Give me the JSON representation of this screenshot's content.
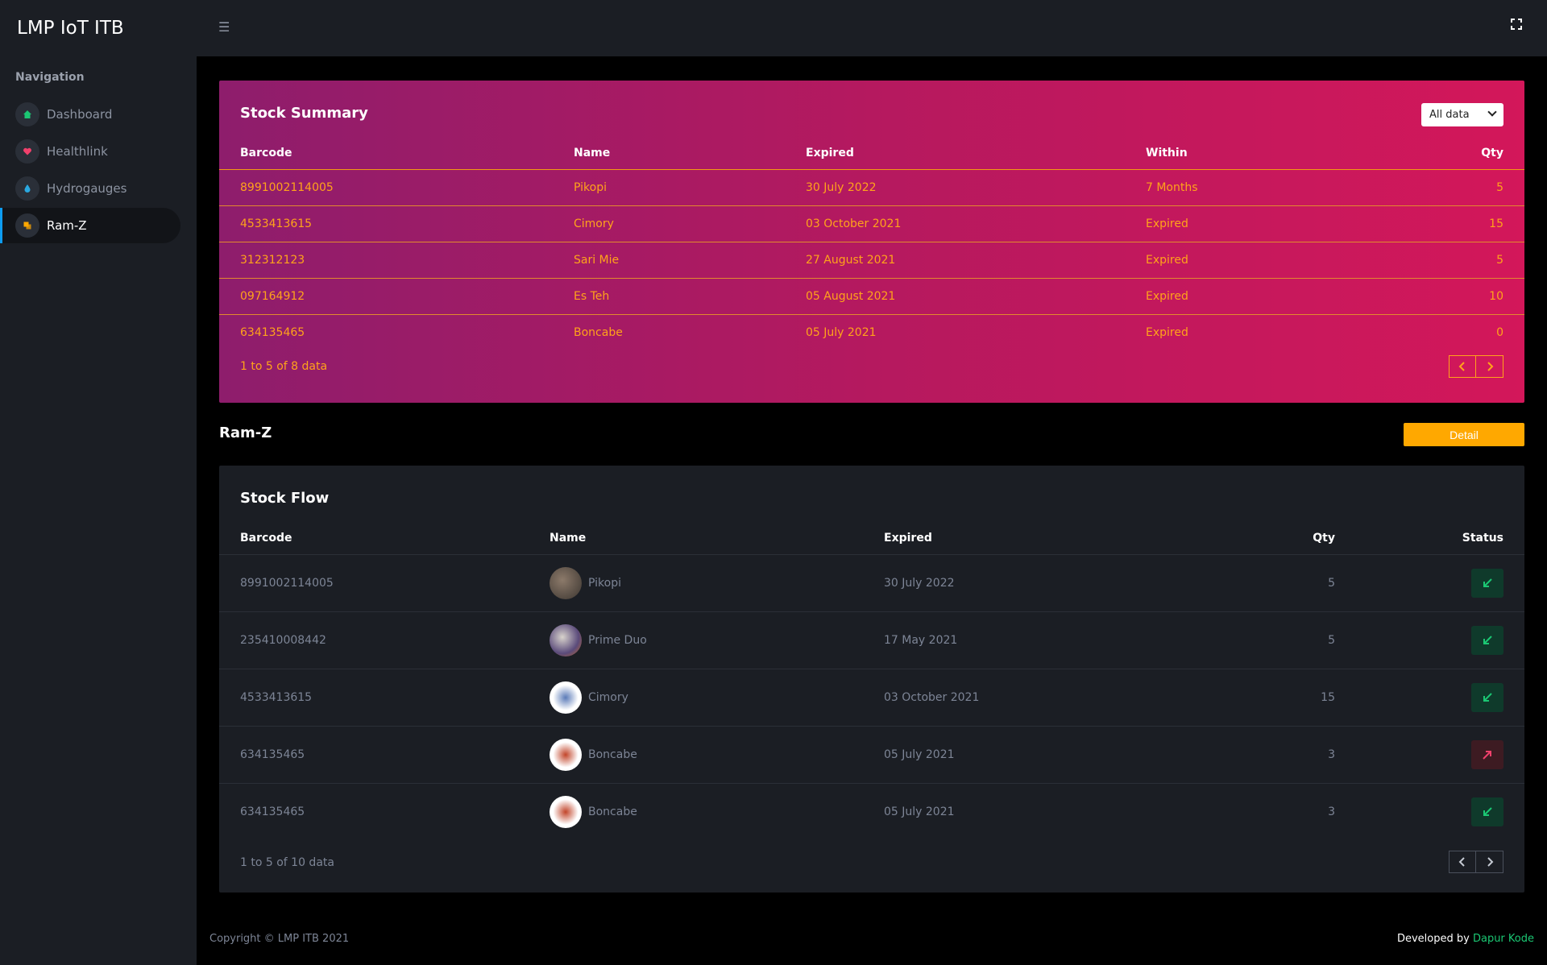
{
  "brand": "LMP IoT ITB",
  "navigation": {
    "heading": "Navigation",
    "items": [
      {
        "label": "Dashboard"
      },
      {
        "label": "Healthlink"
      },
      {
        "label": "Hydrogauges"
      },
      {
        "label": "Ram-Z"
      }
    ]
  },
  "topbar": {
    "menu_icon": "☰"
  },
  "stock_summary": {
    "title": "Stock Summary",
    "filter_value": "All data",
    "columns": [
      "Barcode",
      "Name",
      "Expired",
      "Within",
      "Qty"
    ],
    "rows": [
      [
        "8991002114005",
        "Pikopi",
        "30 July 2022",
        "7 Months",
        "5"
      ],
      [
        "4533413615",
        "Cimory",
        "03 October 2021",
        "Expired",
        "15"
      ],
      [
        "312312123",
        "Sari Mie",
        "27 August 2021",
        "Expired",
        "5"
      ],
      [
        "097164912",
        "Es Teh",
        "05 August 2021",
        "Expired",
        "10"
      ],
      [
        "634135465",
        "Boncabe",
        "05 July 2021",
        "Expired",
        "0"
      ]
    ],
    "pagination": "1 to 5 of 8 data"
  },
  "section": {
    "title": "Ram-Z",
    "detail_label": "Detail"
  },
  "stock_flow": {
    "title": "Stock Flow",
    "columns": [
      "Barcode",
      "Name",
      "Expired",
      "Qty",
      "Status"
    ],
    "rows": [
      {
        "barcode": "8991002114005",
        "name": "Pikopi",
        "expired": "30 July 2022",
        "qty": "5",
        "status": "in"
      },
      {
        "barcode": "235410008442",
        "name": "Prime Duo",
        "expired": "17 May 2021",
        "qty": "5",
        "status": "in"
      },
      {
        "barcode": "4533413615",
        "name": "Cimory",
        "expired": "03 October 2021",
        "qty": "15",
        "status": "in"
      },
      {
        "barcode": "634135465",
        "name": "Boncabe",
        "expired": "05 July 2021",
        "qty": "3",
        "status": "out"
      },
      {
        "barcode": "634135465",
        "name": "Boncabe",
        "expired": "05 July 2021",
        "qty": "3",
        "status": "in"
      }
    ],
    "pagination": "1 to 5 of 10 data"
  },
  "footer": {
    "copyright": "Copyright © LMP ITB 2021",
    "developed_by": "Developed by",
    "developer": "Dapur Kode"
  },
  "colors": {
    "accent": "#0d9cf0",
    "detail_button": "#ffa800",
    "status_in": "#1bc773",
    "status_out": "#f1416c"
  },
  "icons": {
    "dashboard": "home-icon",
    "healthlink": "heart-icon",
    "hydrogauges": "droplet-icon",
    "ramz": "box-icon",
    "status_in": "arrow-down-left-icon",
    "status_out": "arrow-up-right-icon"
  }
}
